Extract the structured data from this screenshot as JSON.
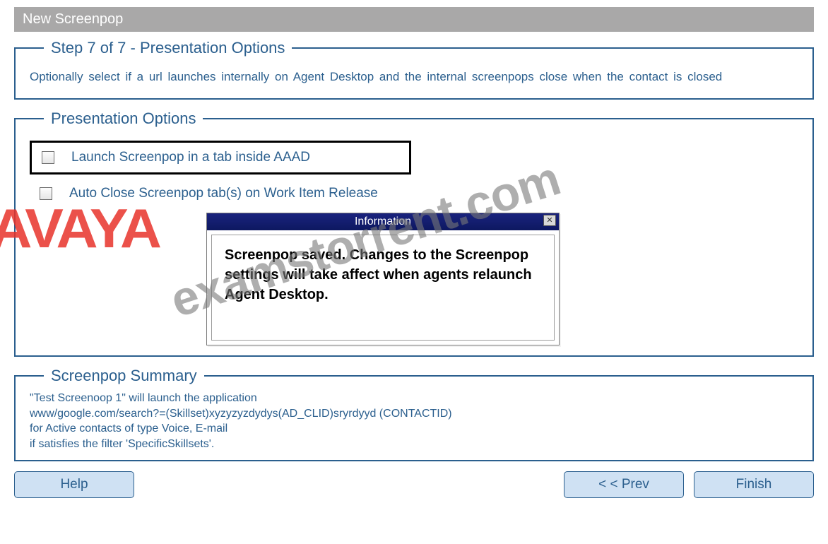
{
  "titleBar": "New Screenpop",
  "step": {
    "legend": "Step 7 of  7 - Presentation Options",
    "description": "Optionally  select  if a url launches  internally  on Agent Desktop  and the internal  screenpops close  when  the  contact  is closed"
  },
  "presentation": {
    "legend": "Presentation Options",
    "options": [
      {
        "label": "Launch Screenpop in a tab inside AAAD",
        "checked": false,
        "highlighted": true
      },
      {
        "label": "Auto Close Screenpop tab(s) on Work Item Release",
        "checked": false,
        "highlighted": false
      }
    ]
  },
  "dialog": {
    "title": "Information",
    "body": "Screenpop saved. Changes to the Screenpop settings will take affect when agents relaunch Agent Desktop.",
    "closeGlyph": "✕"
  },
  "summary": {
    "legend": "Screenpop Summary",
    "line1": "\"Test Screenoop 1\" will launch the application",
    "line2": "www/google.com/search?=(Skillset)xyzyzyzdydys(AD_CLID)sryrdyyd (CONTACTID)",
    "line3": "for Active contacts of type Voice, E-mail",
    "line4": "if satisfies the filter 'SpecificSkillsets'."
  },
  "buttons": {
    "help": "Help",
    "prev": "< < Prev",
    "finish": "Finish"
  },
  "watermarks": {
    "avaya": "AVAYA",
    "exams": "examstorrent.com"
  }
}
